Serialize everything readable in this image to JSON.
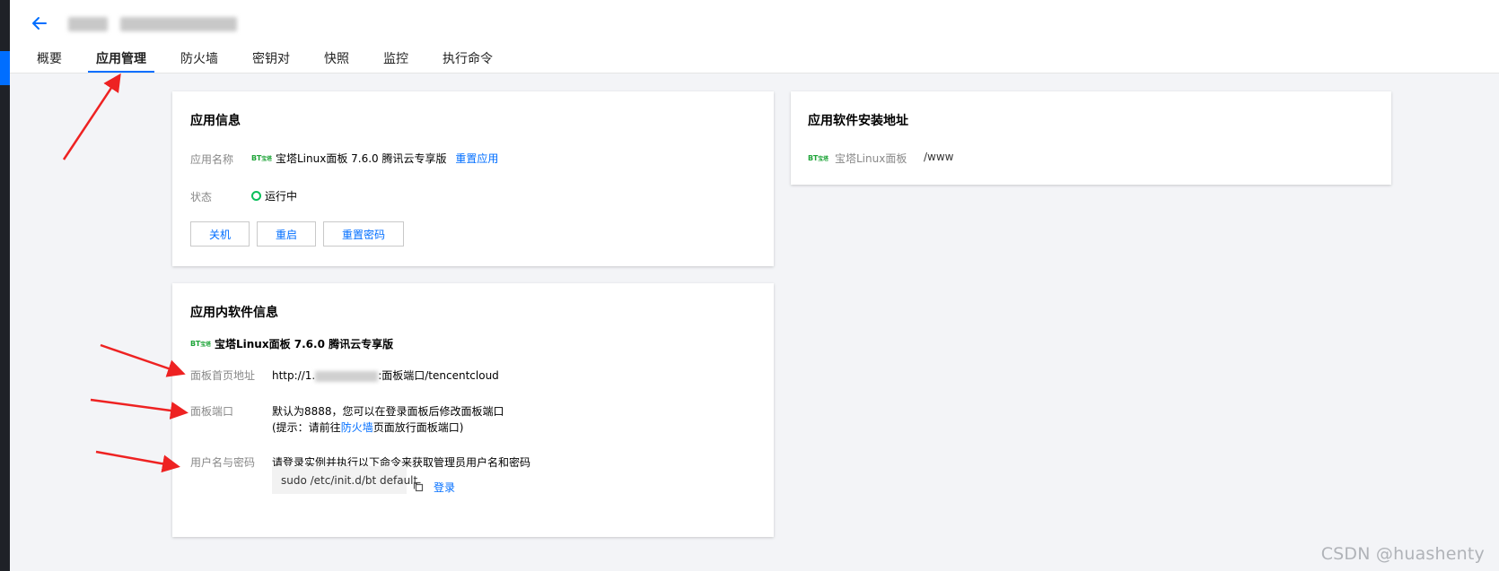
{
  "colors": {
    "accent": "#006eff",
    "annotation_arrow": "#ee2222",
    "running": "#0abf5b",
    "baota_green": "#20a53a"
  },
  "header": {
    "back_icon": "arrow-left-icon",
    "tabs": [
      {
        "label": "概要"
      },
      {
        "label": "应用管理",
        "active": true
      },
      {
        "label": "防火墙"
      },
      {
        "label": "密钥对"
      },
      {
        "label": "快照"
      },
      {
        "label": "监控"
      },
      {
        "label": "执行命令"
      }
    ]
  },
  "app_info": {
    "title": "应用信息",
    "name_label": "应用名称",
    "logo_text": "BT",
    "logo_sub": "宝塔",
    "app_name": "宝塔Linux面板 7.6.0 腾讯云专享版",
    "reset_app_link": "重置应用",
    "status_label": "状态",
    "status_value": "运行中",
    "buttons": {
      "shutdown": "关机",
      "restart": "重启",
      "reset_password": "重置密码"
    }
  },
  "install_path": {
    "title": "应用软件安装地址",
    "logo_text": "BT",
    "logo_sub": "宝塔",
    "software": "宝塔Linux面板",
    "path": "/www"
  },
  "software_info": {
    "title": "应用内软件信息",
    "logo_text": "BT",
    "logo_sub": "宝塔",
    "software_name": "宝塔Linux面板 7.6.0 腾讯云专享版",
    "homepage_label": "面板首页地址",
    "homepage_prefix": "http://1.",
    "homepage_suffix": ":面板端口/tencentcloud",
    "port_label": "面板端口",
    "port_line1": "默认为8888，您可以在登录面板后修改面板端口",
    "port_line2_prefix": "(提示：请前往",
    "port_line2_link": "防火墙",
    "port_line2_suffix": "页面放行面板端口)",
    "credentials_label": "用户名与密码",
    "credentials_text": "请登录实例并执行以下命令来获取管理员用户名和密码",
    "command": "sudo /etc/init.d/bt default",
    "copy_icon": "copy-icon",
    "login_link": "登录"
  },
  "watermark": "CSDN @huashenty"
}
